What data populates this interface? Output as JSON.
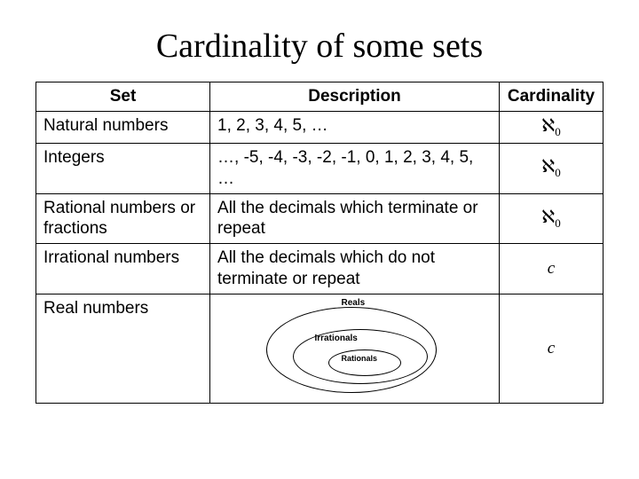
{
  "title": "Cardinality of some sets",
  "headers": {
    "set": "Set",
    "desc": "Description",
    "card": "Cardinality"
  },
  "rows": [
    {
      "set": "Natural numbers",
      "desc": "1, 2, 3, 4, 5, …",
      "card": "ℵ0",
      "card_type": "aleph"
    },
    {
      "set": "Integers",
      "desc": "…, -5, -4, -3, -2, -1, 0, 1, 2, 3, 4, 5, …",
      "card": "ℵ0",
      "card_type": "aleph"
    },
    {
      "set": "Rational numbers or fractions",
      "desc": "All the decimals which terminate or repeat",
      "card": "ℵ0",
      "card_type": "aleph"
    },
    {
      "set": "Irrational numbers",
      "desc": "All the decimals which do not terminate or repeat",
      "card": "c",
      "card_type": "c"
    },
    {
      "set": "Real numbers",
      "desc": "",
      "card": "c",
      "card_type": "c"
    }
  ],
  "aleph_base": "ℵ",
  "aleph_sub": "0",
  "c_symbol": "c",
  "diagram": {
    "reals": "Reals",
    "irrationals": "Irrationals",
    "rationals": "Rationals"
  }
}
